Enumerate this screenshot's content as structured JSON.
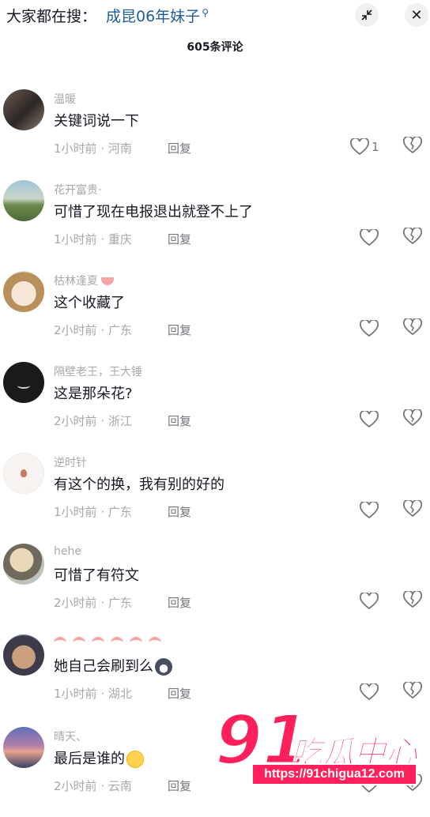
{
  "search": {
    "prefix": "大家都在搜：",
    "term": "成昆06年妹子",
    "icon": "search-icon"
  },
  "header": {
    "collapse_icon": "collapse-icon",
    "close_icon": "close-icon",
    "comment_count": "605条评论"
  },
  "comments": [
    {
      "user": "温暖",
      "text": "关键词说一下",
      "time": "1小时前",
      "location": "河南",
      "reply": "回复",
      "likes": "1"
    },
    {
      "user": "花开富贵·",
      "text": "可惜了现在电报退出就登不上了",
      "time": "1小时前",
      "location": "重庆",
      "reply": "回复",
      "likes": ""
    },
    {
      "user": "枯林逢夏",
      "text": "这个收藏了",
      "time": "2小时前",
      "location": "广东",
      "reply": "回复",
      "likes": ""
    },
    {
      "user": "隔壁老王，王大锤",
      "text": "这是那朵花?",
      "time": "2小时前",
      "location": "浙江",
      "reply": "回复",
      "likes": ""
    },
    {
      "user": "逆时针",
      "text": "有这个的换，我有别的好的",
      "time": "1小时前",
      "location": "广东",
      "reply": "回复",
      "likes": ""
    },
    {
      "user": "hehe",
      "text": "可惜了有符文",
      "time": "2小时前",
      "location": "广东",
      "reply": "回复",
      "likes": ""
    },
    {
      "user": "",
      "text": "她自己会刷到么",
      "time": "1小时前",
      "location": "湖北",
      "reply": "回复",
      "likes": ""
    },
    {
      "user": "晴天、",
      "text": "最后是谁的",
      "time": "2小时前",
      "location": "云南",
      "reply": "回复",
      "likes": ""
    }
  ],
  "meta_separator": " · ",
  "watermark": {
    "number": "91",
    "name": "吃瓜中心",
    "url": "https://91chigua12.com"
  },
  "colors": {
    "link_blue": "#1f5c9c",
    "meta_gray": "#a7a8ad",
    "text": "#161823",
    "watermark_pink": "#ff1f5a"
  }
}
